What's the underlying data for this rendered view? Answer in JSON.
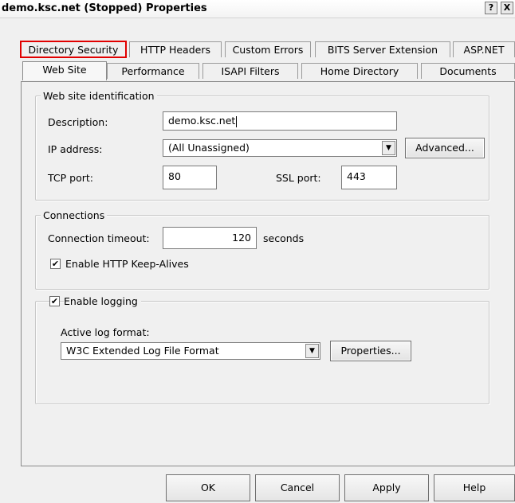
{
  "window": {
    "title": "demo.ksc.net (Stopped) Properties",
    "help_button": "?",
    "close_button": "X"
  },
  "tabs_row1": [
    {
      "label": "Directory Security",
      "highlighted": true
    },
    {
      "label": "HTTP Headers"
    },
    {
      "label": "Custom Errors"
    },
    {
      "label": "BITS Server Extension"
    },
    {
      "label": "ASP.NET"
    }
  ],
  "tabs_row2": [
    {
      "label": "Web Site",
      "active": true
    },
    {
      "label": "Performance"
    },
    {
      "label": "ISAPI Filters"
    },
    {
      "label": "Home Directory"
    },
    {
      "label": "Documents"
    }
  ],
  "web_site_identification": {
    "legend": "Web site identification",
    "description_label": "Description:",
    "description_value": "demo.ksc.net",
    "ip_label": "IP address:",
    "ip_value": "(All Unassigned)",
    "advanced_button": "Advanced...",
    "tcp_label": "TCP port:",
    "tcp_value": "80",
    "ssl_label": "SSL port:",
    "ssl_value": "443"
  },
  "connections": {
    "legend": "Connections",
    "timeout_label": "Connection timeout:",
    "timeout_value": "120",
    "timeout_unit": "seconds",
    "keepalive_label": "Enable HTTP Keep-Alives",
    "keepalive_checked": true
  },
  "logging": {
    "enable_label": "Enable logging",
    "enable_checked": true,
    "format_label": "Active log format:",
    "format_value": "W3C Extended Log File Format",
    "properties_button": "Properties..."
  },
  "buttons": {
    "ok": "OK",
    "cancel": "Cancel",
    "apply": "Apply",
    "help": "Help"
  },
  "colors": {
    "highlight_border": "#e10000",
    "dialog_bg": "#f0f0f0"
  }
}
